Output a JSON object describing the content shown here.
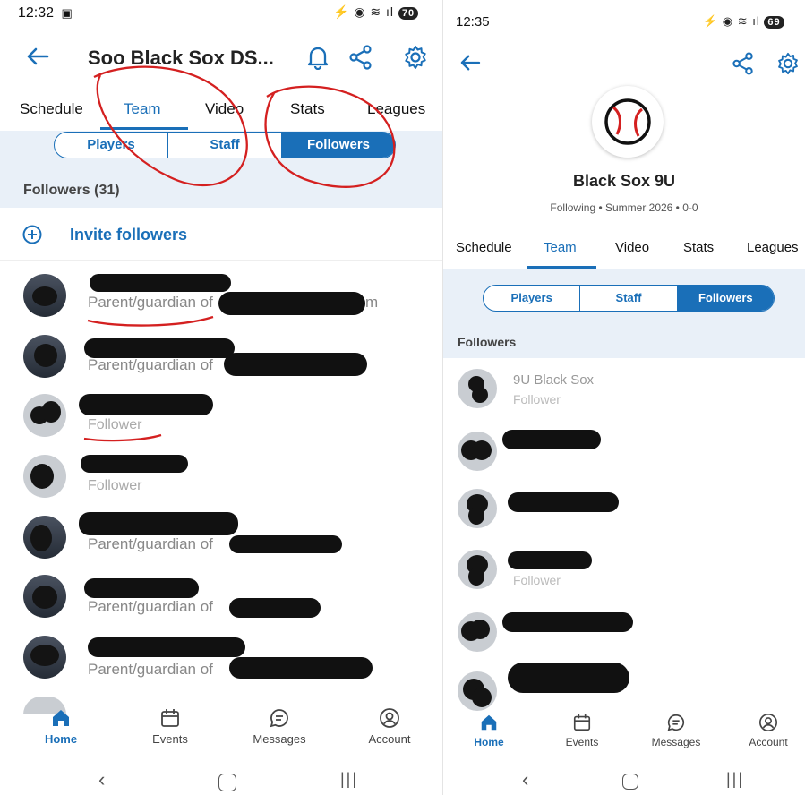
{
  "left": {
    "status": {
      "time": "12:32",
      "signal": "¤ ▿ ≡ .∥∥",
      "battery": "70"
    },
    "header": {
      "title": "Soo Black Sox DS..."
    },
    "tabs": [
      "Schedule",
      "Team",
      "Video",
      "Stats",
      "Leagues"
    ],
    "active_tab": "Team",
    "segments": [
      "Players",
      "Staff",
      "Followers"
    ],
    "active_segment": "Followers",
    "section": "Followers (31)",
    "invite": "Invite followers",
    "rows": [
      {
        "sub": "Parent/guardian of",
        "tail": "m"
      },
      {
        "sub": "Parent/guardian of",
        "tail": ""
      },
      {
        "sub": "Follower",
        "tail": ""
      },
      {
        "sub": "Follower",
        "tail": ""
      },
      {
        "sub": "Parent/guardian of",
        "tail": ""
      },
      {
        "sub": "Parent/guardian of",
        "tail": ""
      },
      {
        "sub": "Parent/guardian of",
        "tail": ""
      }
    ],
    "nav": [
      "Home",
      "Events",
      "Messages",
      "Account"
    ]
  },
  "right": {
    "status": {
      "time": "12:35",
      "battery": "69"
    },
    "team": {
      "name": "Black Sox 9U",
      "meta": "Following • Summer 2026 • 0-0"
    },
    "tabs": [
      "Schedule",
      "Team",
      "Video",
      "Stats",
      "Leagues"
    ],
    "active_tab": "Team",
    "segments": [
      "Players",
      "Staff",
      "Followers"
    ],
    "active_segment": "Followers",
    "section": "Followers",
    "first_row": {
      "name": "9U Black Sox",
      "sub": "Follower"
    },
    "fourth_row_sub": "Follower",
    "nav": [
      "Home",
      "Events",
      "Messages",
      "Account"
    ]
  },
  "colors": {
    "accent": "#1a6fb8",
    "band": "#e9f0f8",
    "annotation": "#d42020"
  },
  "icons": [
    "back-arrow-icon",
    "bell-icon",
    "share-icon",
    "gear-icon",
    "plus-circle-icon",
    "home-icon",
    "calendar-icon",
    "chat-icon",
    "account-icon",
    "baseball-icon"
  ]
}
